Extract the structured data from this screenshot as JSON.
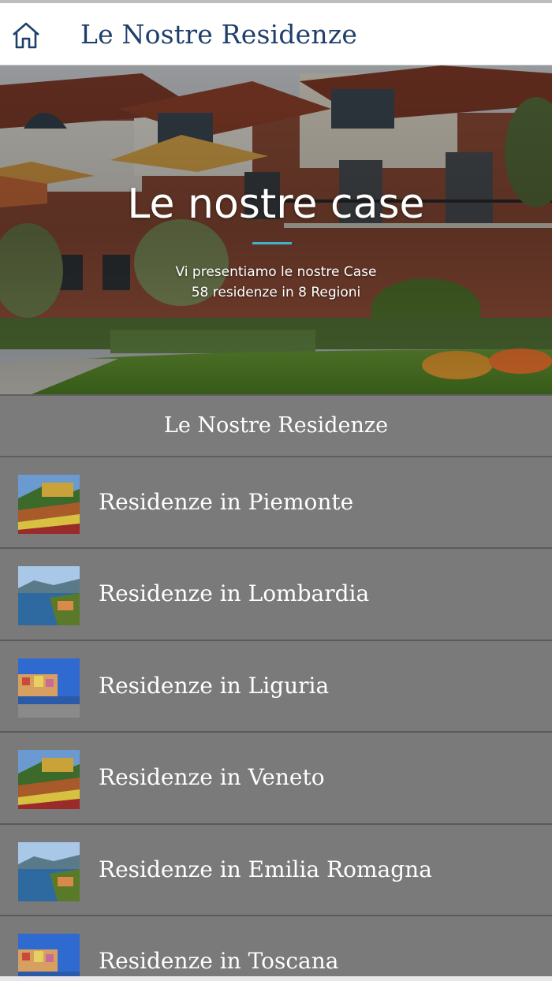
{
  "header": {
    "title": "Le Nostre Residenze",
    "home_icon": "home-icon"
  },
  "hero": {
    "title": "Le nostre case",
    "subtitle_line1": "Vi presentiamo le nostre Case",
    "subtitle_line2": "58 residenze in 8 Regioni",
    "accent_color": "#3fb2c8"
  },
  "section": {
    "title": "Le Nostre Residenze"
  },
  "regions": [
    {
      "label": "Residenze in Piemonte",
      "thumb": "vineyard"
    },
    {
      "label": "Residenze in Lombardia",
      "thumb": "lake"
    },
    {
      "label": "Residenze in Liguria",
      "thumb": "coast"
    },
    {
      "label": "Residenze in Veneto",
      "thumb": "vineyard"
    },
    {
      "label": "Residenze in Emilia Romagna",
      "thumb": "lake"
    },
    {
      "label": "Residenze in Toscana",
      "thumb": "coast"
    }
  ],
  "colors": {
    "header_title": "#1f3f6b",
    "list_background": "#7a7a7a",
    "divider": "#5a5a5a"
  }
}
